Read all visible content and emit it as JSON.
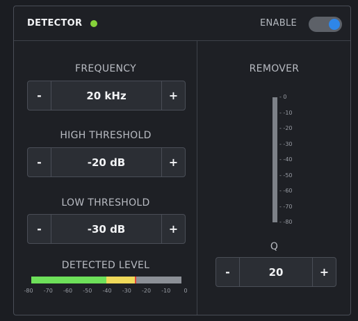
{
  "header": {
    "title": "DETECTOR",
    "enable_label": "ENABLE",
    "enabled": true,
    "status_led_color": "#86d23a",
    "toggle_color": "#2e86e8"
  },
  "frequency": {
    "label": "FREQUENCY",
    "value": "20 kHz",
    "minus": "-",
    "plus": "+"
  },
  "high_threshold": {
    "label": "HIGH THRESHOLD",
    "value": "-20 dB",
    "minus": "-",
    "plus": "+"
  },
  "low_threshold": {
    "label": "LOW THRESHOLD",
    "value": "-30 dB",
    "minus": "-",
    "plus": "+"
  },
  "detected_level": {
    "label": "DETECTED LEVEL",
    "ticks": [
      "-80",
      "-70",
      "-60",
      "-50",
      "-40",
      "-30",
      "-20",
      "-10",
      "0"
    ],
    "segments": [
      {
        "from": -80,
        "to": -40,
        "color": "#6ee05a"
      },
      {
        "from": -40,
        "to": -25,
        "color": "#efd95a"
      },
      {
        "from": -25,
        "to": -24,
        "color": "#e0463a"
      },
      {
        "from": -24,
        "to": 0,
        "color": "#8c9097"
      }
    ]
  },
  "remover": {
    "label": "REMOVER",
    "ticks": [
      "0",
      "-10",
      "-20",
      "-30",
      "-40",
      "-50",
      "-60",
      "-70",
      "-80"
    ],
    "q": {
      "label": "Q",
      "value": "20",
      "minus": "-",
      "plus": "+"
    }
  }
}
